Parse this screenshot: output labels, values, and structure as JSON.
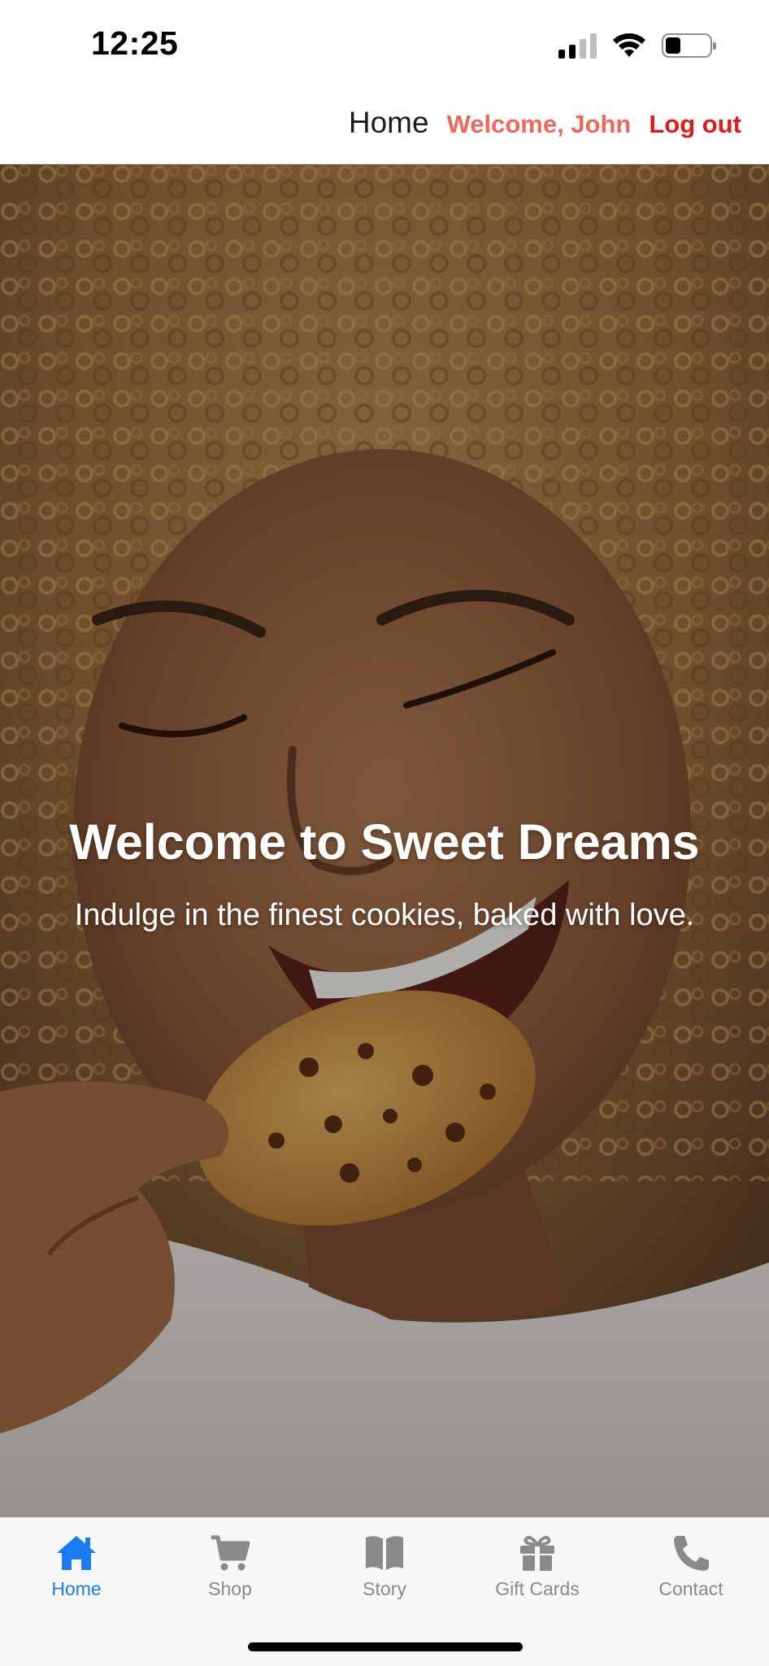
{
  "status_bar": {
    "time": "12:25",
    "battery_level": 0.35
  },
  "top_nav": {
    "home_label": "Home",
    "welcome_text": "Welcome, John",
    "logout_label": "Log out",
    "colors": {
      "welcome": "#f0675d",
      "logout": "#e01a1a"
    }
  },
  "hero": {
    "title": "Welcome to Sweet Dreams",
    "subtitle": "Indulge in the finest cookies, baked with love."
  },
  "tab_bar": {
    "active_color": "#1a7cf0",
    "inactive_color": "#8a8a8a",
    "tabs": [
      {
        "label": "Home",
        "icon": "house-icon",
        "active": true
      },
      {
        "label": "Shop",
        "icon": "cart-icon",
        "active": false
      },
      {
        "label": "Story",
        "icon": "book-icon",
        "active": false
      },
      {
        "label": "Gift Cards",
        "icon": "gift-icon",
        "active": false
      },
      {
        "label": "Contact",
        "icon": "phone-icon",
        "active": false
      }
    ]
  }
}
